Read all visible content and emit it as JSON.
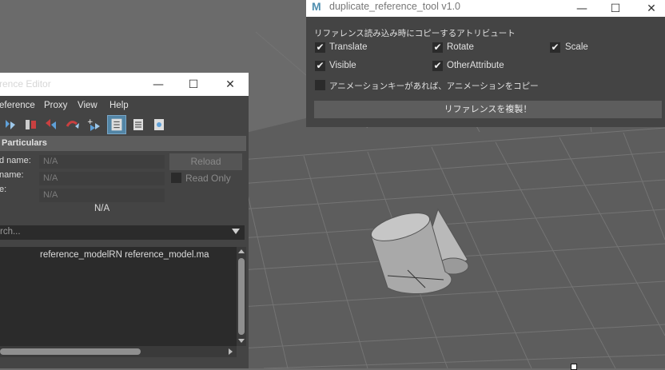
{
  "reference_editor": {
    "title": "rence Editor",
    "window_buttons": {
      "minimize": "—",
      "maximize": "☐",
      "close": "✕"
    },
    "menu": [
      "eference",
      "Proxy",
      "View",
      "Help"
    ],
    "section_title": "Particulars",
    "fields": [
      {
        "label": "d name:",
        "value": "N/A"
      },
      {
        "label": "name:",
        "value": "N/A"
      },
      {
        "label": "e:",
        "value": "N/A"
      }
    ],
    "reload_label": "Reload",
    "read_only_label": "Read Only",
    "center_value": "N/A",
    "search_placeholder": "rch...",
    "list_items": [
      "reference_modelRN reference_model.ma"
    ]
  },
  "dup_tool": {
    "logo": "M",
    "title": "duplicate_reference_tool v1.0",
    "window_buttons": {
      "minimize": "—",
      "maximize": "☐",
      "close": "✕"
    },
    "header": "リファレンス読み込み時にコピーするアトリビュート",
    "checkboxes": [
      {
        "label": "Translate",
        "checked": true
      },
      {
        "label": "Rotate",
        "checked": true
      },
      {
        "label": "Scale",
        "checked": true
      },
      {
        "label": "Visible",
        "checked": true
      },
      {
        "label": "OtherAttribute",
        "checked": true
      }
    ],
    "anim_checkbox": {
      "label": "アニメーションキーがあれば、アニメーションをコピー",
      "checked": false
    },
    "button_label": "リファレンスを複製！",
    "check_glyph": "✔"
  }
}
